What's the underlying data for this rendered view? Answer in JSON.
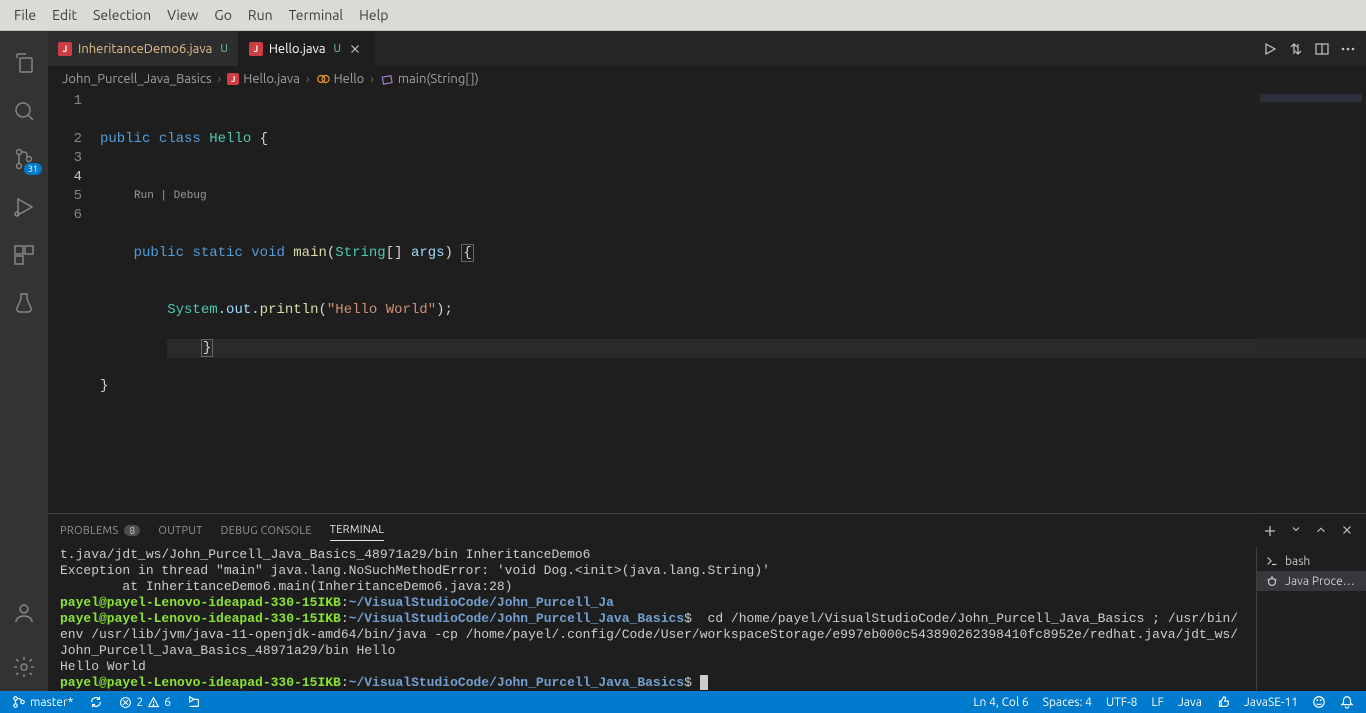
{
  "menu": [
    "File",
    "Edit",
    "Selection",
    "View",
    "Go",
    "Run",
    "Terminal",
    "Help"
  ],
  "activity": {
    "scm_badge": "31"
  },
  "tabs": [
    {
      "name": "InheritanceDemo6.java",
      "status": "U",
      "active": false,
      "dirty": true
    },
    {
      "name": "Hello.java",
      "status": "U",
      "active": true,
      "dirty": false
    }
  ],
  "breadcrumbs": {
    "folder": "John_Purcell_Java_Basics",
    "file": "Hello.java",
    "class": "Hello",
    "method": "main(String[])"
  },
  "codelens": "Run | Debug",
  "code": {
    "l1": {
      "kw1": "public",
      "kw2": "class",
      "cls": "Hello",
      "brace": " {"
    },
    "l2": {
      "kw1": "public",
      "kw2": "static",
      "kw3": "void",
      "m": "main",
      "p1": "(",
      "t": "String",
      "arr": "[] ",
      "arg": "args",
      "p2": ")",
      " brace": " {"
    },
    "l3": {
      "sys": "System",
      "dot1": ".",
      "out": "out",
      "dot2": ".",
      "pl": "println",
      "p1": "(",
      "str": "\"Hello World\"",
      "p2": ");"
    },
    "l4": "    }",
    "l5": "}"
  },
  "line_numbers": [
    "1",
    "2",
    "3",
    "4",
    "5",
    "6"
  ],
  "panel": {
    "tabs": {
      "problems": "PROBLEMS",
      "problems_count": "8",
      "output": "OUTPUT",
      "debug": "DEBUG CONSOLE",
      "terminal": "TERMINAL"
    }
  },
  "terminal": {
    "l1": "t.java/jdt_ws/John_Purcell_Java_Basics_48971a29/bin InheritanceDemo6",
    "l2": "Exception in thread \"main\" java.lang.NoSuchMethodError: 'void Dog.<init>(java.lang.String)'",
    "l3": "        at InheritanceDemo6.main(InheritanceDemo6.java:28)",
    "prompt_user": "payel@payel-Lenovo-ideapad-330-15IKB",
    "prompt_path_short": "~/VisualStudioCode/John_Purcell_Ja",
    "prompt_path": "~/VisualStudioCode/John_Purcell_Java_Basics",
    "cmd": "  cd /home/payel/VisualStudioCode/John_Purcell_Java_Basics ; /usr/bin/env /usr/lib/jvm/java-11-openjdk-amd64/bin/java -cp /home/payel/.config/Code/User/workspaceStorage/e997eb000c543890262398410fc8952e/redhat.java/jdt_ws/John_Purcell_Java_Basics_48971a29/bin Hello",
    "out": "Hello World",
    "dollar": "$"
  },
  "terminal_list": [
    {
      "label": "bash",
      "icon": "terminal"
    },
    {
      "label": "Java Proce…",
      "icon": "bug"
    }
  ],
  "status": {
    "branch": "master*",
    "errors": "2",
    "warnings": "6",
    "ln": "Ln 4, Col 6",
    "spaces": "Spaces: 4",
    "encoding": "UTF-8",
    "eol": "LF",
    "lang": "Java",
    "jdk": "JavaSE-11"
  }
}
